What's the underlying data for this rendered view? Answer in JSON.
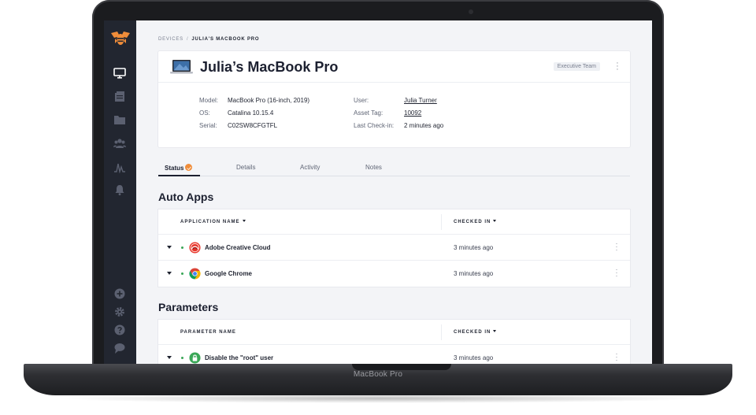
{
  "breadcrumb": {
    "parent": "Devices",
    "current": "Julia's MacBook Pro"
  },
  "device": {
    "title": "Julia’s MacBook Pro",
    "team": "Executive Team",
    "fields_left": [
      {
        "label": "Model:",
        "value": "MacBook Pro (16-inch, 2019)"
      },
      {
        "label": "OS:",
        "value": "Catalina 10.15.4"
      },
      {
        "label": "Serial:",
        "value": "C02SW8CFGTFL"
      }
    ],
    "fields_right": [
      {
        "label": "User:",
        "value": "Julia Turner"
      },
      {
        "label": "Asset Tag:",
        "value": "10092"
      },
      {
        "label": "Last Check-in:",
        "value": "2 minutes ago"
      }
    ]
  },
  "tabs": [
    {
      "label": "Status"
    },
    {
      "label": "Details"
    },
    {
      "label": "Activity"
    },
    {
      "label": "Notes"
    }
  ],
  "auto_apps": {
    "title": "Auto Apps",
    "col_name": "Application Name",
    "col_checked": "Checked In",
    "rows": [
      {
        "name": "Adobe Creative Cloud",
        "checked": "3 minutes ago",
        "icon": "adobe-cc-icon"
      },
      {
        "name": "Google Chrome",
        "checked": "3 minutes ago",
        "icon": "chrome-icon"
      }
    ]
  },
  "parameters": {
    "title": "Parameters",
    "col_name": "Parameter Name",
    "col_checked": "Checked In",
    "rows": [
      {
        "name": "Disable the \"root\" user",
        "checked": "3 minutes ago",
        "icon": "lock-icon"
      }
    ]
  },
  "laptop": {
    "label": "MacBook Pro"
  },
  "colors": {
    "sidebar": "#222630",
    "accent": "#f08d3a",
    "status_ok": "#3aa757"
  }
}
